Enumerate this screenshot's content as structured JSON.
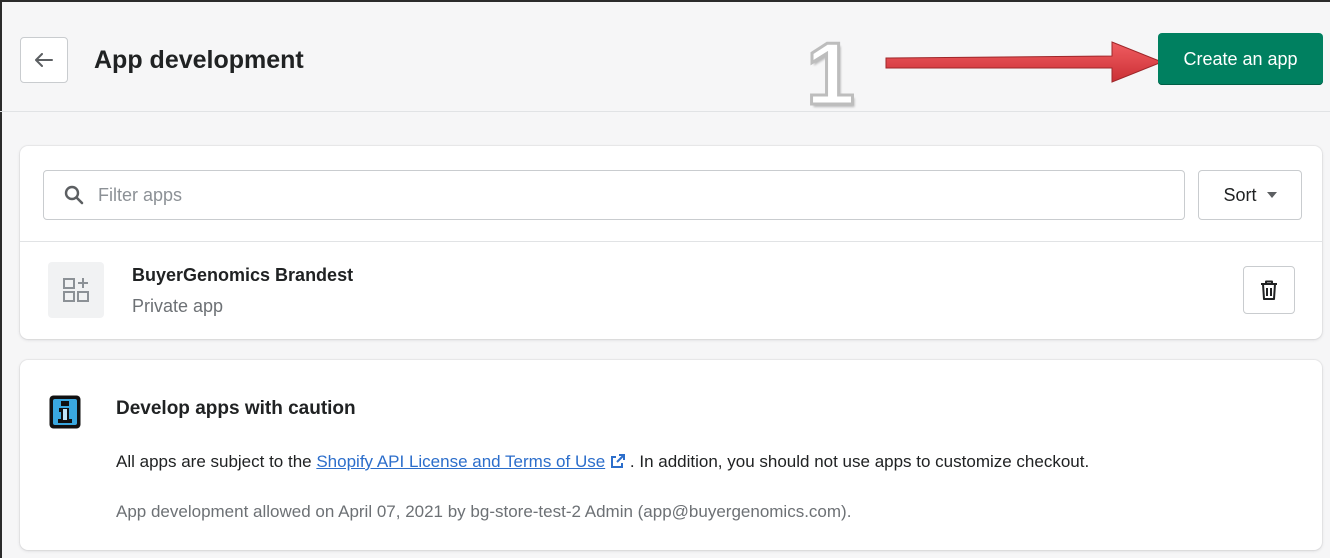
{
  "header": {
    "title": "App development",
    "back_icon": "arrow-left-icon",
    "create_button_label": "Create an app",
    "create_button_color": "#008060"
  },
  "annotation": {
    "number": "1",
    "arrow_color": "#e8383d"
  },
  "filter": {
    "placeholder": "Filter apps",
    "value": "",
    "sort_label": "Sort"
  },
  "apps": [
    {
      "name": "BuyerGenomics Brandest",
      "type": "Private app"
    }
  ],
  "info": {
    "title": "Develop apps with caution",
    "text_prefix": "All apps are subject to the ",
    "link_text": "Shopify API License and Terms of Use",
    "text_suffix": " . In addition, you should not use apps to customize checkout.",
    "note": "App development allowed on April 07, 2021 by bg-store-test-2 Admin (app@buyergenomics.com)."
  }
}
